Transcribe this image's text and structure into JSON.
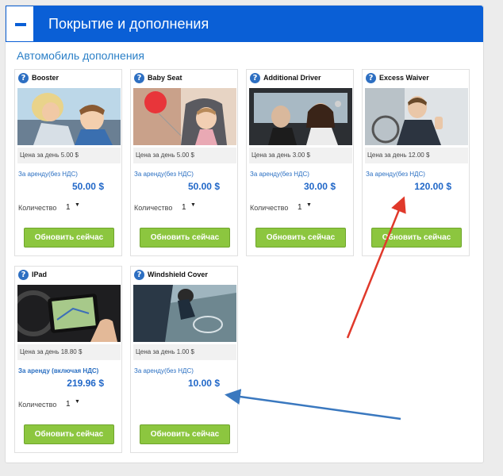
{
  "panel": {
    "title": "Покрытие и дополнения",
    "section_title": "Автомобиль дополнения"
  },
  "cards": [
    {
      "name": "Booster",
      "per_day": "Цена за день 5.00 $",
      "rent_label": "За аренду(без НДС)",
      "price": "50.00 $",
      "qty_label": "Количество",
      "qty": "1",
      "button": "Обновить сейчас"
    },
    {
      "name": "Baby Seat",
      "per_day": "Цена за день 5.00 $",
      "rent_label": "За аренду(без НДС)",
      "price": "50.00 $",
      "qty_label": "Количество",
      "qty": "1",
      "button": "Обновить сейчас"
    },
    {
      "name": "Additional Driver",
      "per_day": "Цена за день 3.00 $",
      "rent_label": "За аренду(без НДС)",
      "price": "30.00 $",
      "qty_label": "Количество",
      "qty": "1",
      "button": "Обновить сейчас"
    },
    {
      "name": "Excess Waiver",
      "per_day": "Цена за день 12.00 $",
      "rent_label": "За аренду(без НДС)",
      "price": "120.00 $",
      "button": "Обновить сейчас"
    },
    {
      "name": "IPad",
      "per_day": "Цена за день 18.80 $",
      "rent_label": "За аренду (включая НДС)",
      "price": "219.96 $",
      "qty_label": "Количество",
      "qty": "1",
      "button": "Обновить сейчас"
    },
    {
      "name": "Windshield Cover",
      "per_day": "Цена за день 1.00 $",
      "rent_label": "За аренду(без НДС)",
      "price": "10.00 $",
      "button": "Обновить сейчас"
    }
  ],
  "colors": {
    "header": "#0a5fd6",
    "button": "#8cc63f",
    "price": "#2268c8",
    "arrow_red": "#e0392b",
    "arrow_blue": "#3a78bf"
  },
  "icons": [
    "help-icon",
    "collapse-icon",
    "chevron-down-icon"
  ]
}
